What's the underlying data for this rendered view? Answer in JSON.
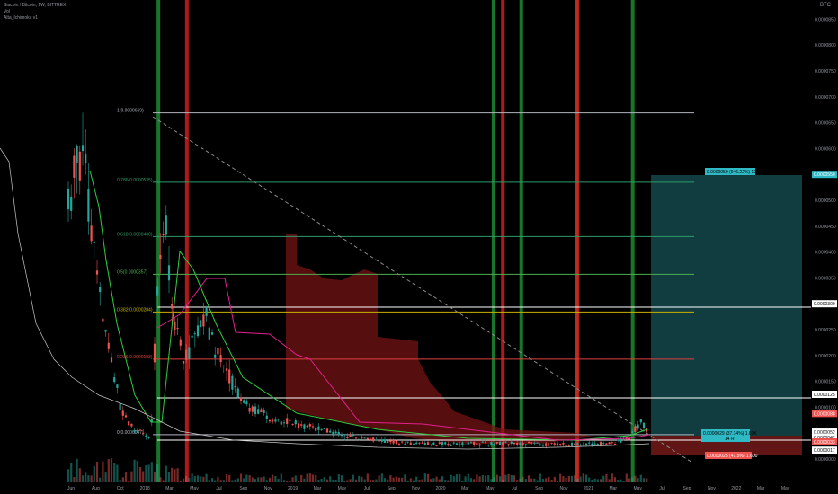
{
  "legend": {
    "symbol": "Siacoin / Bitcoin, 1W, BITTREX",
    "volume": "Vol",
    "indicator": "Alta_Ichimoku v1"
  },
  "currency": "BTC",
  "colors": {
    "bg": "#000000",
    "up": "#26a69a",
    "down": "#ef5350",
    "green": "#1f9d3a",
    "red": "#e01e1e",
    "magenta": "#e0208f",
    "gray": "#c8c8c8",
    "cloud": "#7a1414",
    "teal": "#1f6f74",
    "fib": "#2e9c6a"
  },
  "chart_data": {
    "type": "candlestick",
    "y_axis": {
      "min": 0.0,
      "max": 1e-06,
      "ticks": [
        "0.0000000",
        "0.0000050",
        "0.0000100",
        "0.0000150",
        "0.0000200",
        "0.0000250",
        "0.0000300",
        "0.0000350",
        "0.0000400",
        "0.0000450",
        "0.0000500",
        "0.0000550",
        "0.0000600",
        "0.0000650",
        "0.0000700",
        "0.0000750",
        "0.0000800",
        "0.0000850",
        "0.0000900"
      ]
    },
    "x_axis": {
      "labels": [
        "Jun",
        "Aug",
        "Oct",
        "2018",
        "Mar",
        "May",
        "Jul",
        "Sep",
        "Nov",
        "2019",
        "Mar",
        "May",
        "Jul",
        "Sep",
        "Nov",
        "2020",
        "Mar",
        "May",
        "Jul",
        "Sep",
        "Nov",
        "2021",
        "Mar",
        "May",
        "Jul",
        "Sep",
        "Nov",
        "2022",
        "Mar",
        "May"
      ]
    },
    "price_markers": [
      {
        "label": "0.0000550",
        "value": 5.5e-05,
        "color": "#2fb9c4"
      },
      {
        "label": "0.0000300",
        "value": 3e-05,
        "color": "#ffffff"
      },
      {
        "label": "0.0000125",
        "value": 1.25e-05,
        "color": "#ffffff"
      },
      {
        "label": "0.0000088",
        "value": 8.8e-06,
        "color": "#ef5350"
      },
      {
        "label": "0.0000052",
        "value": 5.2e-06,
        "color": "#ffffff"
      },
      {
        "label": "0.0000042",
        "value": 4.2e-06,
        "color": "#ffffff"
      },
      {
        "label": "0.0000033",
        "value": 3.3e-06,
        "color": "#ef5350"
      },
      {
        "label": "0.0000017",
        "value": 1.7e-06,
        "color": "#ffffff"
      }
    ],
    "fib_levels": [
      {
        "label": "1(0.0000669)",
        "value": 6.69e-05,
        "color": "#b2b5be"
      },
      {
        "label": "0.786(0.0000535)",
        "value": 5.35e-05,
        "color": "#2e9c6a"
      },
      {
        "label": "0.618(0.0000430)",
        "value": 4.3e-05,
        "color": "#2e9c6a"
      },
      {
        "label": "0.5(0.0000357)",
        "value": 3.57e-05,
        "color": "#4caf50"
      },
      {
        "label": "0.382(0.0000284)",
        "value": 2.84e-05,
        "color": "#c9b300"
      },
      {
        "label": "0.236(0.0000193)",
        "value": 1.93e-05,
        "color": "#e04040"
      },
      {
        "label": "0(0.0000047)",
        "value": 4.7e-06,
        "color": "#b2b5be"
      }
    ],
    "position_labels": {
      "target": "0.0000050 (946.22%) 12800",
      "entry": "0.0000029 (37.14%) 1.60K",
      "entry_sub": "14 R",
      "stop": "0.0000025 (47.5%) 1.600"
    },
    "vertical_lines": {
      "green": [
        0.189,
        0.589,
        0.622,
        0.688,
        0.755
      ],
      "red": [
        0.223,
        0.6,
        0.689
      ]
    }
  }
}
